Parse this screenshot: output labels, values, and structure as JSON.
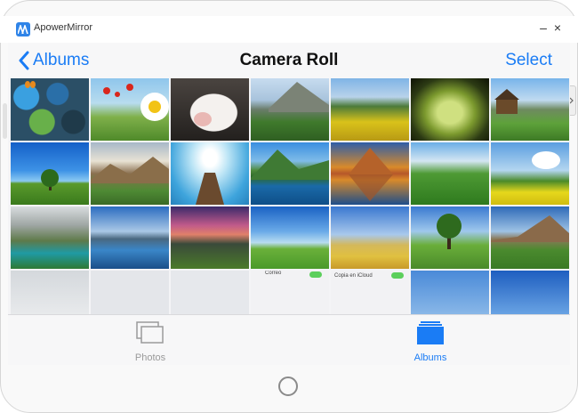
{
  "window": {
    "app_name": "ApowerMirror",
    "minimize_label": "–",
    "close_label": "×"
  },
  "navbar": {
    "back_label": "Albums",
    "title": "Camera Roll",
    "select_label": "Select"
  },
  "tabbar": {
    "photos_label": "Photos",
    "albums_label": "Albums"
  },
  "settings_peek": {
    "item1": "Correo",
    "item2": "Copia en iCloud"
  },
  "colors": {
    "accent": "#1a7cf5",
    "tab_inactive": "#9a9a9a"
  }
}
